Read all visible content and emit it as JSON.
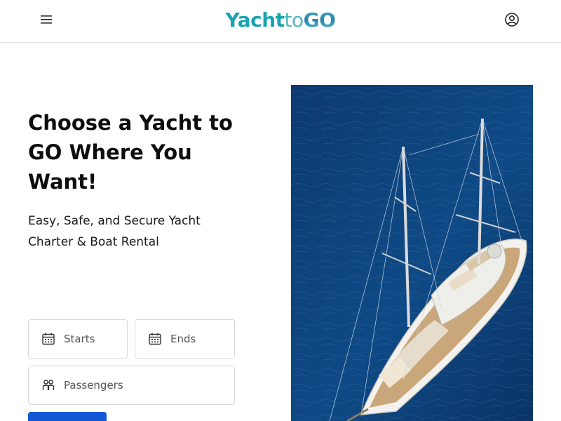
{
  "header": {
    "logo": {
      "part1": "Yacht",
      "part2": "to",
      "part3": "GO"
    },
    "menu_icon": "hamburger-menu-icon",
    "account_icon": "user-account-icon"
  },
  "hero": {
    "title": "Choose a Yacht to GO Where You Want!",
    "subtitle": "Easy, Safe, and Secure Yacht Charter & Boat Rental",
    "image": "aerial-sailing-yacht-photo"
  },
  "booking": {
    "starts": {
      "label": "Starts",
      "icon": "calendar-icon"
    },
    "ends": {
      "label": "Ends",
      "icon": "calendar-icon"
    },
    "passengers": {
      "label": "Passengers",
      "icon": "people-icon"
    }
  },
  "colors": {
    "brand": "#1aa3b0",
    "primary_button": "#1457d6",
    "sea": "#0d3d73"
  }
}
